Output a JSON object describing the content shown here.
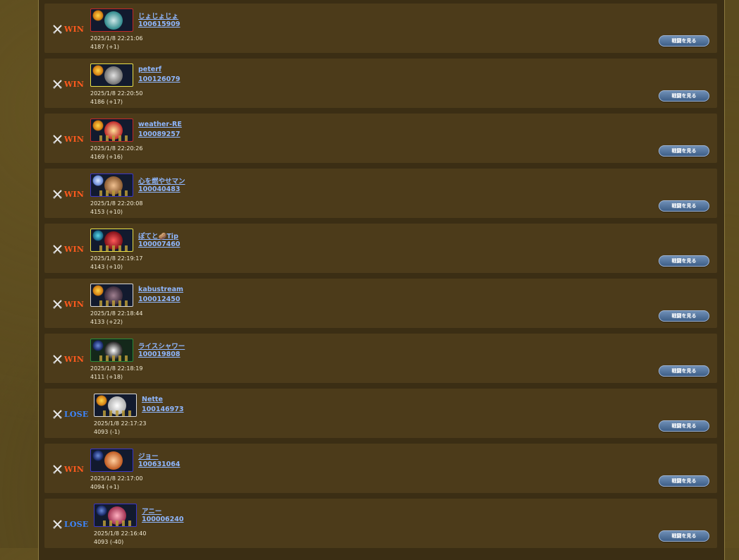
{
  "matches": [
    {
      "result": "WIN",
      "name": "じょじょじょ",
      "uid": "100615909",
      "time": "2025/1/8 22:21:06",
      "rating": "4187 (+1)",
      "button": "戦闘を見る",
      "frame": "#c0282a",
      "portrait": "#2f8a8c"
    },
    {
      "result": "WIN",
      "name": "peterf",
      "uid": "100126079",
      "time": "2025/1/8 22:20:50",
      "rating": "4186 (+17)",
      "button": "戦闘を見る",
      "frame": "#e8e04a",
      "portrait": "#8c8c8c"
    },
    {
      "result": "WIN",
      "name": "weather-RE",
      "uid": "100089257",
      "time": "2025/1/8 22:20:26",
      "rating": "4169 (+16)",
      "button": "戦闘を見る",
      "frame": "#c0282a",
      "portrait": "#d8a830"
    },
    {
      "result": "WIN",
      "name": "心を燃やせマン",
      "uid": "100040483",
      "time": "2025/1/8 22:20:08",
      "rating": "4153 (+10)",
      "button": "戦闘を見る",
      "frame": "#3a36c8",
      "portrait": "#d79a60"
    },
    {
      "result": "WIN",
      "name": "ぽてと🥔Tip",
      "uid": "100007460",
      "time": "2025/1/8 22:19:17",
      "rating": "4143 (+10)",
      "button": "戦闘を見る",
      "frame": "#e8e04a",
      "portrait": "#c02030"
    },
    {
      "result": "WIN",
      "name": "kabustream",
      "uid": "100012450",
      "time": "2025/1/8 22:18:44",
      "rating": "4133 (+22)",
      "button": "戦闘を見る",
      "frame": "#d8d8d8",
      "portrait": "#6a5060"
    },
    {
      "result": "WIN",
      "name": "ライスシャワー",
      "uid": "100019808",
      "time": "2025/1/8 22:18:19",
      "rating": "4111 (+18)",
      "button": "戦闘を見る",
      "frame": "#2a8a3a",
      "portrait": "#e0e0e0"
    },
    {
      "result": "LOSE",
      "name": "Nette",
      "uid": "100146973",
      "time": "2025/1/8 22:17:23",
      "rating": "4093 (-1)",
      "button": "戦闘を見る",
      "frame": "#d8d8d8",
      "portrait": "#e8e8e8"
    },
    {
      "result": "WIN",
      "name": "ジョー",
      "uid": "100631064",
      "time": "2025/1/8 22:17:00",
      "rating": "4094 (+1)",
      "button": "戦闘を見る",
      "frame": "#3a36c8",
      "portrait": "#e08a40"
    },
    {
      "result": "LOSE",
      "name": "アニー",
      "uid": "100006240",
      "time": "2025/1/8 22:16:40",
      "rating": "4093 (-40)",
      "button": "戦闘を見る",
      "frame": "#3a36c8",
      "portrait": "#d05a70"
    }
  ],
  "colors": {
    "win": "#ff5a1e",
    "lose": "#3d86ff",
    "link": "#8fb7ff",
    "row_bg": "#4c3b1a"
  },
  "icons": {
    "result": "crossed-swords-icon"
  }
}
